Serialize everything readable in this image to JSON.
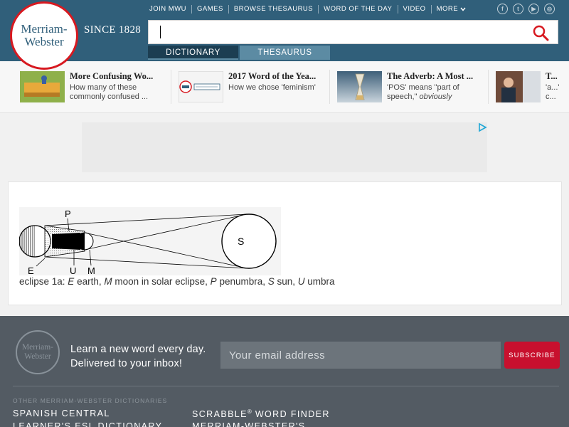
{
  "header": {
    "logo_line1": "Merriam-",
    "logo_line2": "Webster",
    "since": "SINCE 1828",
    "nav": [
      "JOIN MWU",
      "GAMES",
      "BROWSE THESAURUS",
      "WORD OF THE DAY",
      "VIDEO",
      "MORE"
    ],
    "social_icons": [
      "facebook-icon",
      "twitter-icon",
      "youtube-icon",
      "instagram-icon"
    ],
    "search": {
      "value": "",
      "placeholder": ""
    },
    "tabs": {
      "dictionary": "DICTIONARY",
      "thesaurus": "THESAURUS"
    }
  },
  "promos": [
    {
      "title": "More Confusing Wo...",
      "desc": "How many of these commonly confused ..."
    },
    {
      "title": "2017 Word of the Yea...",
      "desc": "How we chose 'feminism'"
    },
    {
      "title": "The Adverb: A Most ...",
      "desc_part1": "'POS' means \"part of speech,\" ",
      "desc_italic": "obviously"
    },
    {
      "title": "T...",
      "desc": "'a...' c..."
    }
  ],
  "art": {
    "labels": {
      "p": "P",
      "e": "E",
      "u": "U",
      "m": "M",
      "s": "S"
    },
    "caption": {
      "prefix": "eclipse 1a: ",
      "e": "E",
      "e_text": " earth, ",
      "m": "M",
      "m_text": " moon in solar eclipse, ",
      "p": "P",
      "p_text": " penumbra, ",
      "s": "S",
      "s_text": " sun, ",
      "u": "U",
      "u_text": " umbra"
    }
  },
  "footer": {
    "logo_line1": "Merriam-",
    "logo_line2": "Webster",
    "newsletter_line1": "Learn a new word every day.",
    "newsletter_line2": "Delivered to your inbox!",
    "email_placeholder": "Your email address",
    "subscribe_label": "SUBSCRIBE",
    "other_dicts_heading": "OTHER MERRIAM-WEBSTER DICTIONARIES",
    "links": [
      "SPANISH CENTRAL",
      "LEARNER'S ESL DICTIONARY",
      "SCRABBLE",
      "® ",
      "WORD FINDER",
      "MERRIAM-WEBSTER'S"
    ]
  },
  "colors": {
    "header_bg": "#305f7a",
    "logo_red": "#d71920",
    "tab_active": "#1c3e52",
    "tab_inactive": "#5c8ba3",
    "footer_bg": "#535b63",
    "subscribe_red": "#c8102e"
  }
}
